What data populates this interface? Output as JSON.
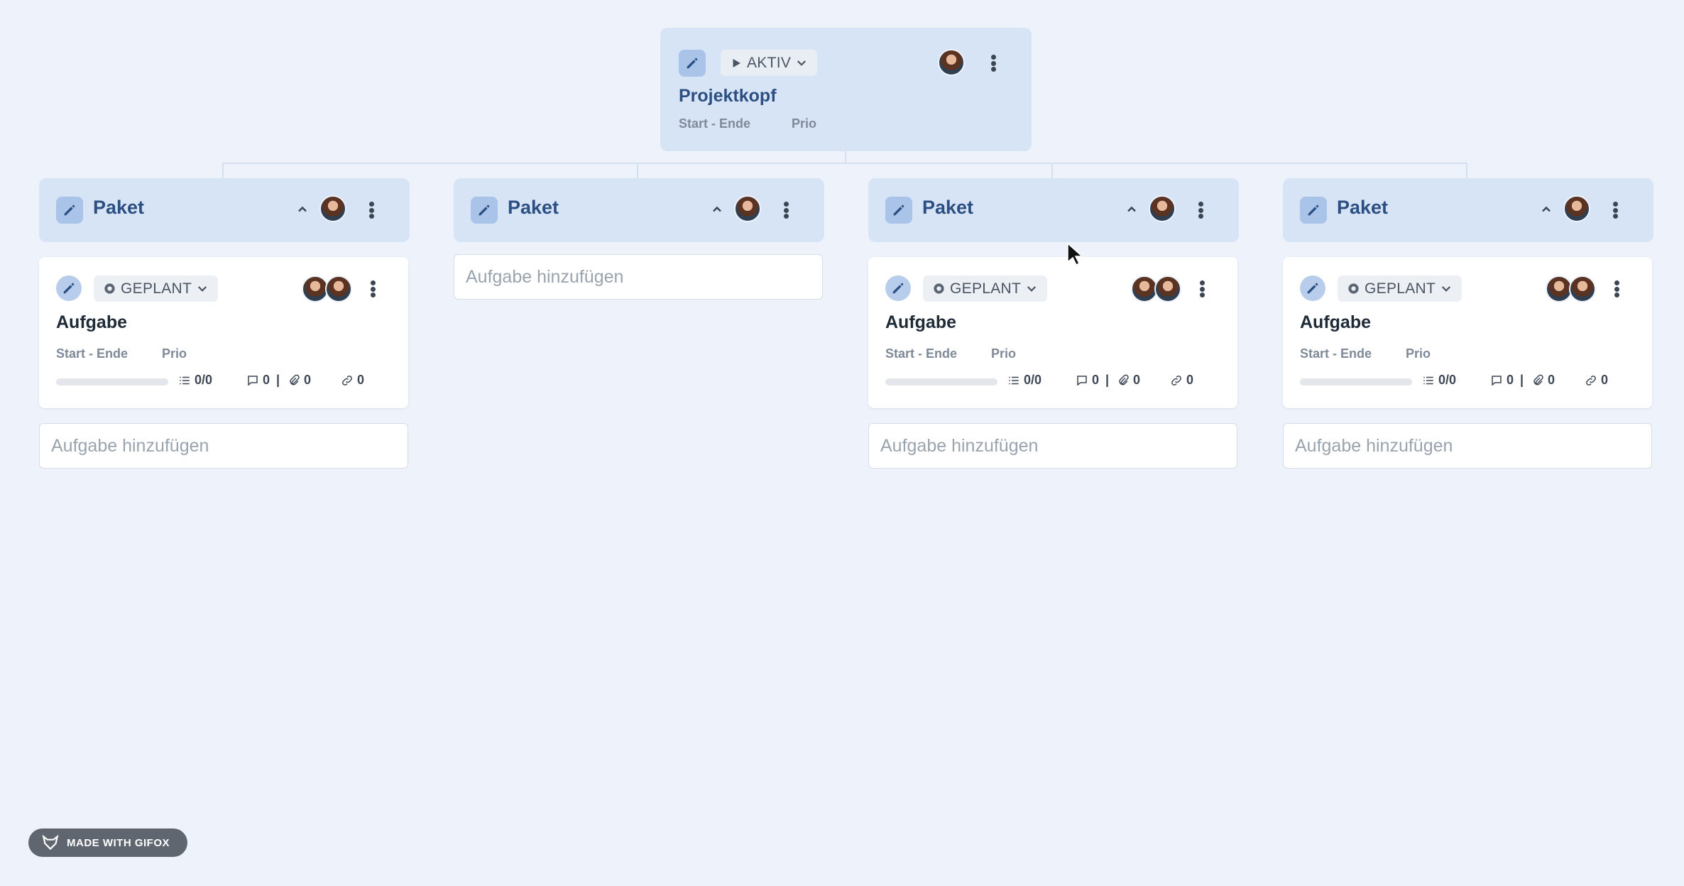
{
  "header": {
    "status": "AKTIV",
    "title": "Projektkopf",
    "dates": "Start - Ende",
    "prio": "Prio"
  },
  "packages": [
    {
      "title": "Paket",
      "add_task": "Aufgabe hinzufügen",
      "task": {
        "status": "GEPLANT",
        "title": "Aufgabe",
        "dates": "Start - Ende",
        "prio": "Prio",
        "checklist": "0/0",
        "comments": "0",
        "attachments": "0",
        "links": "0"
      }
    },
    {
      "title": "Paket",
      "add_task": "Aufgabe hinzufügen"
    },
    {
      "title": "Paket",
      "add_task": "Aufgabe hinzufügen",
      "task": {
        "status": "GEPLANT",
        "title": "Aufgabe",
        "dates": "Start - Ende",
        "prio": "Prio",
        "checklist": "0/0",
        "comments": "0",
        "attachments": "0",
        "links": "0"
      }
    },
    {
      "title": "Paket",
      "add_task": "Aufgabe hinzufügen",
      "task": {
        "status": "GEPLANT",
        "title": "Aufgabe",
        "dates": "Start - Ende",
        "prio": "Prio",
        "checklist": "0/0",
        "comments": "0",
        "attachments": "0",
        "links": "0"
      }
    }
  ],
  "watermark": "MADE WITH GIFOX",
  "colors": {
    "background": "#eef3fb",
    "card_header": "#d7e4f5",
    "accent": "#2b4f82",
    "edit_button": "#a9c3e9"
  },
  "icons": [
    "pencil-icon",
    "play-icon",
    "chevron-down-icon",
    "chevron-up-icon",
    "kebab-icon",
    "checklist-icon",
    "comment-icon",
    "paperclip-icon",
    "link-icon",
    "fox-icon"
  ]
}
